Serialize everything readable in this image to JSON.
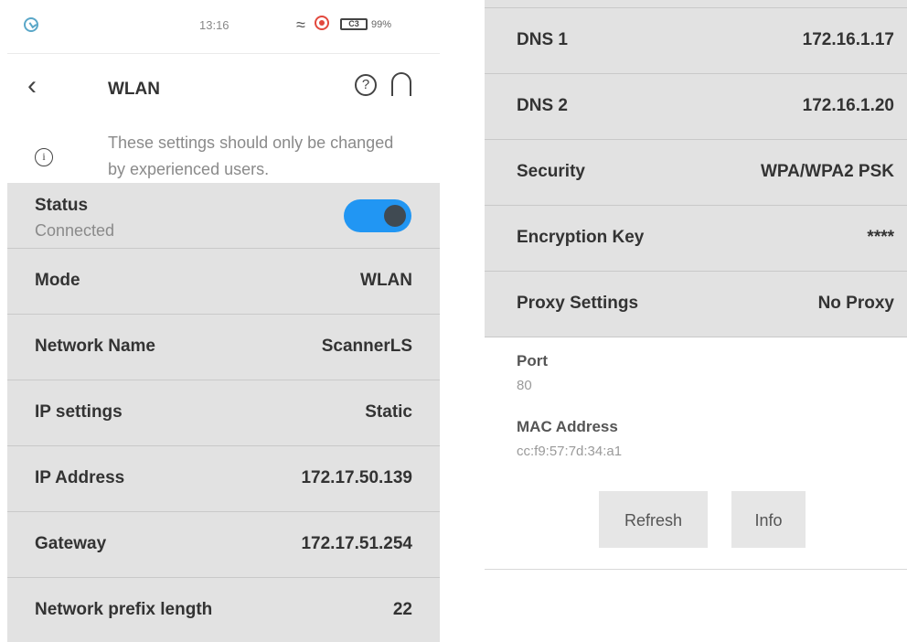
{
  "status_bar": {
    "time": "13:16",
    "battery_label": "C3",
    "battery_pct": "99%"
  },
  "header": {
    "title": "WLAN",
    "help_glyph": "?"
  },
  "notice": {
    "text": "These settings should only be changed by experienced users.",
    "icon_glyph": "i"
  },
  "left_rows": {
    "status": {
      "label": "Status",
      "value": "Connected",
      "toggle_on": true
    },
    "mode": {
      "label": "Mode",
      "value": "WLAN"
    },
    "network_name": {
      "label": "Network Name",
      "value": "ScannerLS"
    },
    "ip_settings": {
      "label": "IP settings",
      "value": "Static"
    },
    "ip_address": {
      "label": "IP Address",
      "value": "172.17.50.139"
    },
    "gateway": {
      "label": "Gateway",
      "value": "172.17.51.254"
    },
    "prefix": {
      "label": "Network prefix length",
      "value": "22"
    }
  },
  "right_rows": {
    "dns1": {
      "label": "DNS 1",
      "value": "172.16.1.17"
    },
    "dns2": {
      "label": "DNS 2",
      "value": "172.16.1.20"
    },
    "security": {
      "label": "Security",
      "value": "WPA/WPA2 PSK"
    },
    "encryption": {
      "label": "Encryption Key",
      "value": "****"
    },
    "proxy": {
      "label": "Proxy Settings",
      "value": "No Proxy"
    }
  },
  "details": {
    "port": {
      "label": "Port",
      "value": "80"
    },
    "mac": {
      "label": "MAC Address",
      "value": "cc:f9:57:7d:34:a1"
    }
  },
  "buttons": {
    "refresh": "Refresh",
    "info": "Info"
  },
  "colors": {
    "accent": "#2196f3",
    "row_bg": "#e2e2e2",
    "muted_text": "#8a8a8a"
  }
}
